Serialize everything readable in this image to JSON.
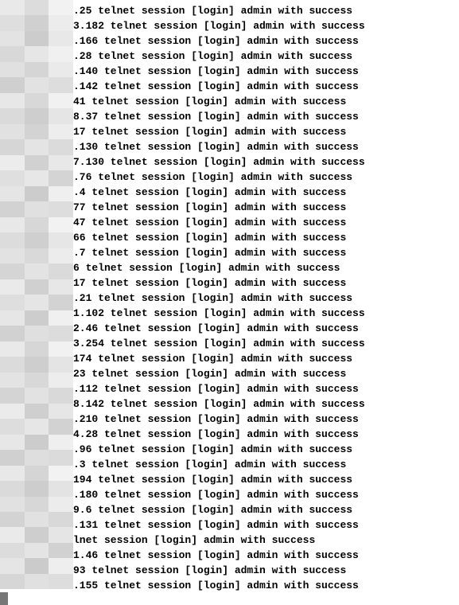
{
  "log": {
    "suffix": " telnet session [login] admin with success",
    "prefixes": [
      ".25",
      "3.182",
      ".166",
      ".28",
      ".140",
      ".142",
      "41",
      "8.37",
      "17",
      ".130",
      "7.130",
      ".76",
      ".4",
      "77",
      "47",
      "66",
      ".7",
      "6",
      "17",
      ".21",
      "1.102",
      "2.46",
      "3.254",
      "174",
      "23",
      ".112",
      "8.142",
      ".210",
      "4.28",
      ".96",
      ".3",
      "194",
      ".180",
      "9.6",
      ".131",
      "lnet session [login] admin with success",
      "1.46",
      "93",
      ".155"
    ]
  },
  "gutter": {
    "cols": 3,
    "shades": [
      [
        "#e9e9e9",
        "#dcdcdc",
        "#f2f2f2"
      ],
      [
        "#dedede",
        "#d0d0d0",
        "#ececec"
      ],
      [
        "#e3e3e3",
        "#cccccc",
        "#e8e8e8"
      ],
      [
        "#d8d8d8",
        "#e6e6e6",
        "#f0f0f0"
      ],
      [
        "#e0e0e0",
        "#d5d5d5",
        "#eaeaea"
      ],
      [
        "#cfcfcf",
        "#e2e2e2",
        "#dddddd"
      ],
      [
        "#e7e7e7",
        "#d8d8d8",
        "#f1f1f1"
      ],
      [
        "#dadada",
        "#cecece",
        "#e5e5e5"
      ],
      [
        "#e1e1e1",
        "#d3d3d3",
        "#ededed"
      ],
      [
        "#d6d6d6",
        "#e4e4e4",
        "#dbdbdb"
      ],
      [
        "#ececec",
        "#d1d1d1",
        "#e8e8e8"
      ],
      [
        "#dfdfdf",
        "#e7e7e7",
        "#d4d4d4"
      ],
      [
        "#e5e5e5",
        "#cccccc",
        "#efefef"
      ],
      [
        "#d2d2d2",
        "#e0e0e0",
        "#dddddd"
      ],
      [
        "#e8e8e8",
        "#d7d7d7",
        "#f2f2f2"
      ],
      [
        "#dcdcdc",
        "#cfcfcf",
        "#e6e6e6"
      ],
      [
        "#e2e2e2",
        "#d9d9d9",
        "#ececec"
      ],
      [
        "#d5d5d5",
        "#e3e3e3",
        "#dadada"
      ],
      [
        "#eaeaea",
        "#d0d0d0",
        "#e7e7e7"
      ],
      [
        "#dedede",
        "#e5e5e5",
        "#d3d3d3"
      ],
      [
        "#e6e6e6",
        "#cdcdcd",
        "#f0f0f0"
      ],
      [
        "#d1d1d1",
        "#dfdfdf",
        "#dcdcdc"
      ],
      [
        "#e9e9e9",
        "#d6d6d6",
        "#f1f1f1"
      ],
      [
        "#dbdbdb",
        "#cecece",
        "#e4e4e4"
      ],
      [
        "#e3e3e3",
        "#d8d8d8",
        "#ededed"
      ],
      [
        "#d4d4d4",
        "#e2e2e2",
        "#d9d9d9"
      ],
      [
        "#ebebeb",
        "#cfcfcf",
        "#e6e6e6"
      ],
      [
        "#dddddd",
        "#e6e6e6",
        "#d2d2d2"
      ],
      [
        "#e7e7e7",
        "#cccccc",
        "#efefef"
      ],
      [
        "#d0d0d0",
        "#dedede",
        "#dbdbdb"
      ],
      [
        "#e8e8e8",
        "#d5d5d5",
        "#f2f2f2"
      ],
      [
        "#dadada",
        "#cdcdcd",
        "#e3e3e3"
      ],
      [
        "#e1e1e1",
        "#d7d7d7",
        "#ececec"
      ],
      [
        "#d3d3d3",
        "#e1e1e1",
        "#d8d8d8"
      ],
      [
        "#eaeaea",
        "#cecece",
        "#e5e5e5"
      ],
      [
        "#dcdcdc",
        "#e4e4e4",
        "#d1d1d1"
      ],
      [
        "#e5e5e5",
        "#cbcbcb",
        "#eeeeee"
      ],
      [
        "#d6d6d6",
        "#e0e0e0",
        "#dddddd"
      ],
      [
        "#ffffff",
        "#ffffff",
        "#ffffff"
      ]
    ]
  }
}
